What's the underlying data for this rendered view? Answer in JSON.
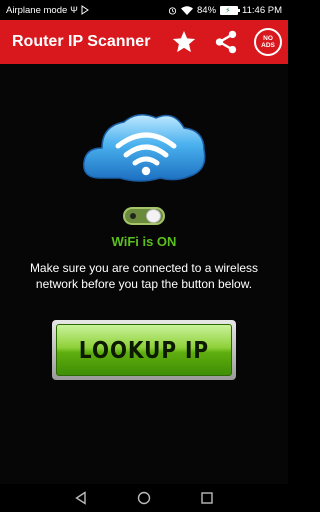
{
  "status_bar": {
    "left_text": "Airplane mode",
    "usb_symbol": "Ψ",
    "battery_percent": "84%",
    "time": "11:46 PM"
  },
  "app_bar": {
    "title": "Router IP Scanner",
    "no_ads_line1": "NO",
    "no_ads_line2": "ADS",
    "background_color": "#d8181d"
  },
  "main": {
    "wifi_status": "WiFi is ON",
    "wifi_status_color": "#5bbf1f",
    "instructions": "Make sure you are connected to a wireless network before you tap the button below.",
    "lookup_button_label": "LOOKUP IP"
  },
  "icons": {
    "star": "star-icon",
    "share": "share-icon",
    "no_ads": "no-ads-icon",
    "wifi_cloud": "wifi-cloud-icon",
    "back": "back-icon",
    "home": "home-icon",
    "recents": "recents-icon"
  }
}
